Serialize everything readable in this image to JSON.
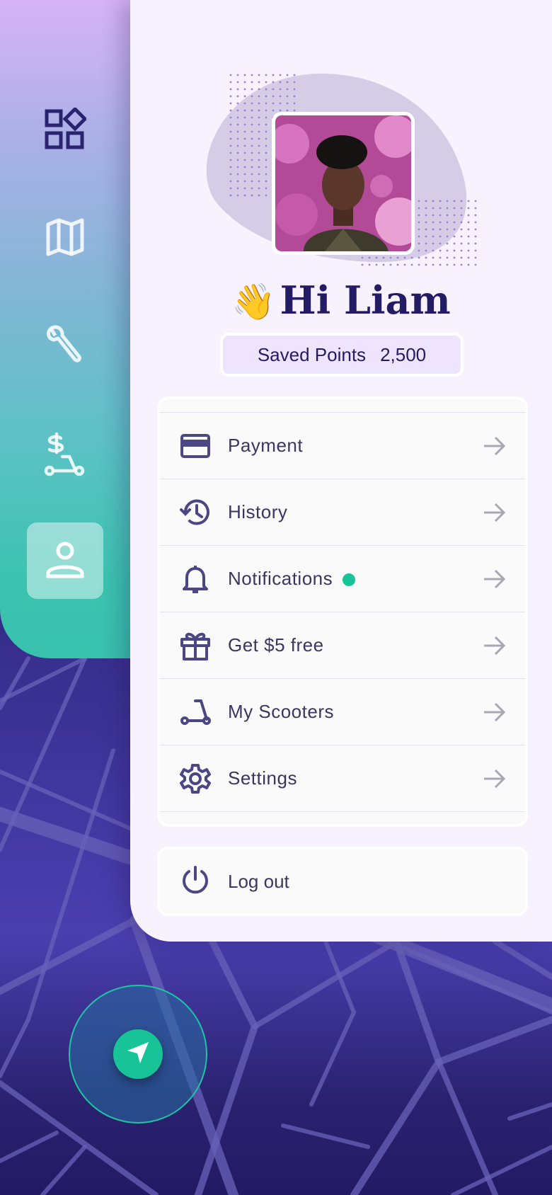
{
  "sidebar": {
    "items": [
      {
        "name": "dashboard",
        "icon": "dashboard-icon"
      },
      {
        "name": "map",
        "icon": "map-icon"
      },
      {
        "name": "service",
        "icon": "wrench-icon"
      },
      {
        "name": "rental",
        "icon": "scooter-dollar-icon"
      },
      {
        "name": "profile",
        "icon": "user-icon",
        "active": true
      }
    ]
  },
  "profile": {
    "wave": "👋",
    "greeting": "Hi Liam",
    "points_label": "Saved Points",
    "points_value": "2,500"
  },
  "menu": {
    "items": [
      {
        "label": "Payment",
        "icon": "credit-card-icon"
      },
      {
        "label": "History",
        "icon": "history-icon"
      },
      {
        "label": "Notifications",
        "icon": "bell-icon",
        "badge": true
      },
      {
        "label": "Get $5 free",
        "icon": "gift-icon"
      },
      {
        "label": "My Scooters",
        "icon": "scooter-icon"
      },
      {
        "label": "Settings",
        "icon": "gear-icon"
      }
    ],
    "logout_label": "Log out"
  },
  "colors": {
    "accent": "#18c497",
    "icon": "#4b4784",
    "heading": "#231b63",
    "panel": "#f7f2fe"
  }
}
